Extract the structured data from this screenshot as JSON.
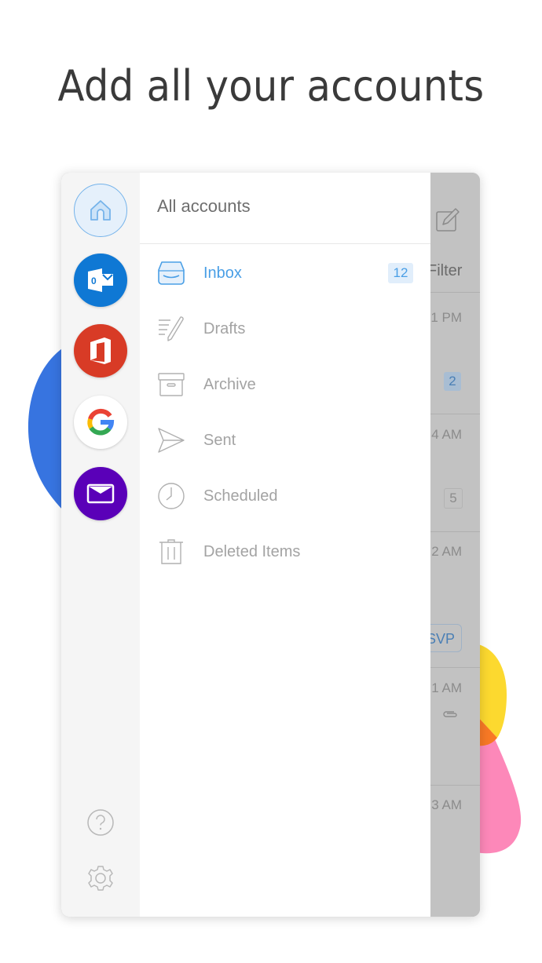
{
  "headline": "Add all your accounts",
  "colors": {
    "accent_blue": "#4a9fe6",
    "outlook_blue": "#0f78d4",
    "office_red": "#d83b26",
    "mail_purple": "#5a00b8",
    "blob_blue": "#3774e0",
    "blob_yellow": "#fcd92f",
    "blob_pink": "#fd88b9",
    "blob_orange": "#f87925"
  },
  "accounts_rail": {
    "accounts": [
      {
        "name": "All accounts",
        "icon": "home-icon"
      },
      {
        "name": "Outlook",
        "icon": "outlook-icon"
      },
      {
        "name": "Office 365",
        "icon": "office-icon"
      },
      {
        "name": "Google",
        "icon": "google-icon"
      },
      {
        "name": "Mail",
        "icon": "mail-envelope-icon"
      }
    ],
    "help_icon": "help-icon",
    "settings_icon": "gear-icon"
  },
  "folder_panel": {
    "title": "All accounts",
    "folders": [
      {
        "label": "Inbox",
        "icon": "inbox-icon",
        "count": "12",
        "active": true
      },
      {
        "label": "Drafts",
        "icon": "drafts-icon"
      },
      {
        "label": "Archive",
        "icon": "archive-icon"
      },
      {
        "label": "Sent",
        "icon": "sent-icon"
      },
      {
        "label": "Scheduled",
        "icon": "clock-icon"
      },
      {
        "label": "Deleted Items",
        "icon": "trash-icon"
      }
    ]
  },
  "background_list": {
    "compose_icon": "compose-icon",
    "filter_label": "Filter",
    "items": [
      {
        "time": "1 PM",
        "badge": "2"
      },
      {
        "time": "4 AM",
        "badge": "5"
      },
      {
        "time": "2 AM",
        "action": "SVP"
      },
      {
        "time": "1 AM",
        "attachment": true
      },
      {
        "time": "3 AM"
      }
    ]
  }
}
